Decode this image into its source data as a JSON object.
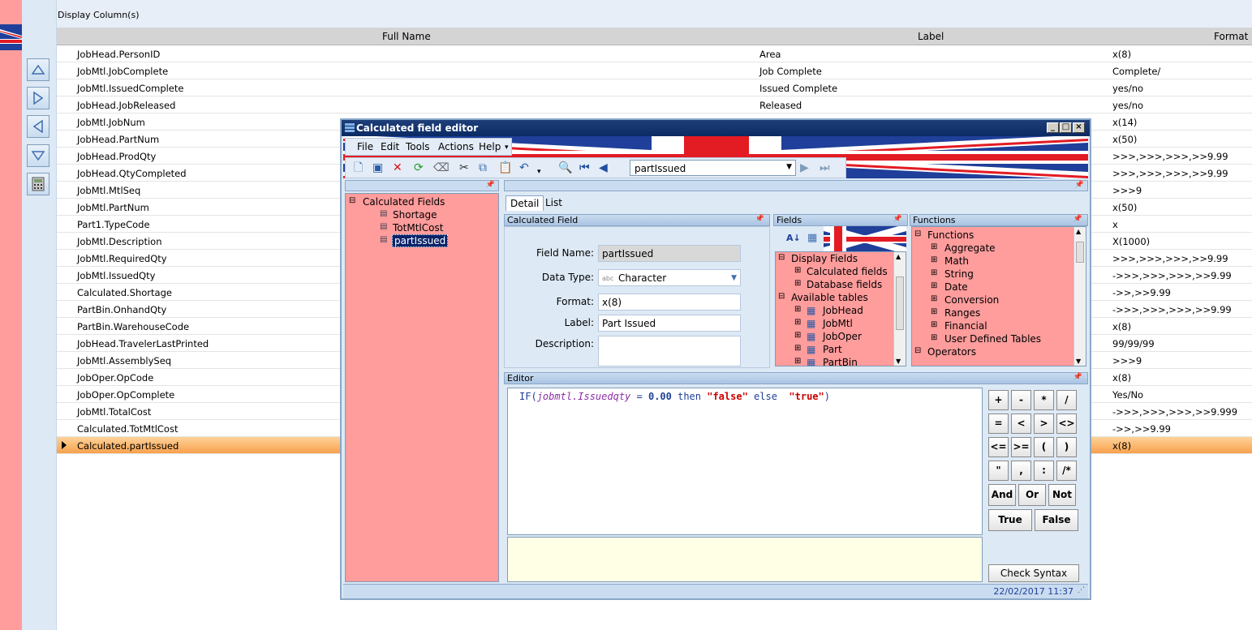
{
  "top_bar": {
    "title": "Display Column(s)"
  },
  "grid": {
    "headers": {
      "full_name": "Full Name",
      "label": "Label",
      "format": "Format"
    },
    "rows": [
      {
        "full_name": "JobHead.PersonID",
        "label": "Area",
        "format": "x(8)"
      },
      {
        "full_name": "JobMtl.JobComplete",
        "label": "Job Complete",
        "format": "Complete/"
      },
      {
        "full_name": "JobMtl.IssuedComplete",
        "label": "Issued Complete",
        "format": "yes/no"
      },
      {
        "full_name": "JobHead.JobReleased",
        "label": "Released",
        "format": "yes/no"
      },
      {
        "full_name": "JobMtl.JobNum",
        "label": "",
        "format": "x(14)"
      },
      {
        "full_name": "JobHead.PartNum",
        "label": "",
        "format": "x(50)"
      },
      {
        "full_name": "JobHead.ProdQty",
        "label": "",
        "format": ">>>,>>>,>>>,>>9.99"
      },
      {
        "full_name": "JobHead.QtyCompleted",
        "label": "",
        "format": ">>>,>>>,>>>,>>9.99"
      },
      {
        "full_name": "JobMtl.MtlSeq",
        "label": "",
        "format": ">>>9"
      },
      {
        "full_name": "JobMtl.PartNum",
        "label": "",
        "format": "x(50)"
      },
      {
        "full_name": "Part1.TypeCode",
        "label": "",
        "format": "x"
      },
      {
        "full_name": "JobMtl.Description",
        "label": "",
        "format": "X(1000)"
      },
      {
        "full_name": "JobMtl.RequiredQty",
        "label": "",
        "format": ">>>,>>>,>>>,>>9.99"
      },
      {
        "full_name": "JobMtl.IssuedQty",
        "label": "",
        "format": "->>>,>>>,>>>,>>9.99"
      },
      {
        "full_name": "Calculated.Shortage",
        "label": "",
        "format": "->>,>>9.99"
      },
      {
        "full_name": "PartBin.OnhandQty",
        "label": "",
        "format": "->>>,>>>,>>>,>>9.99"
      },
      {
        "full_name": "PartBin.WarehouseCode",
        "label": "",
        "format": "x(8)"
      },
      {
        "full_name": "JobHead.TravelerLastPrinted",
        "label": "",
        "format": "99/99/99"
      },
      {
        "full_name": "JobMtl.AssemblySeq",
        "label": "",
        "format": ">>>9"
      },
      {
        "full_name": "JobOper.OpCode",
        "label": "",
        "format": "x(8)"
      },
      {
        "full_name": "JobOper.OpComplete",
        "label": "",
        "format": "Yes/No"
      },
      {
        "full_name": "JobMtl.TotalCost",
        "label": "",
        "format": "->>>,>>>,>>>,>>9.999"
      },
      {
        "full_name": "Calculated.TotMtlCost",
        "label": "",
        "format": "->>,>>9.99"
      },
      {
        "full_name": "Calculated.partIssued",
        "label": "",
        "format": "x(8)"
      }
    ]
  },
  "dialog": {
    "title": "Calculated field editor",
    "menu": [
      "File",
      "Edit",
      "Tools",
      "Actions",
      "Help"
    ],
    "search_value": "partIssued",
    "tree": {
      "root": "Calculated Fields",
      "items": [
        "Shortage",
        "TotMtlCost",
        "partIssued"
      ]
    },
    "tabs": [
      "Detail",
      "List"
    ],
    "calc_panel": {
      "header": "Calculated Field",
      "field_name_label": "Field Name:",
      "field_name": "partIssued",
      "data_type_label": "Data Type:",
      "data_type_prefix": "abc",
      "data_type": "Character",
      "format_label": "Format:",
      "format": "x(8)",
      "label_label": "Label:",
      "label": "Part Issued",
      "description_label": "Description:"
    },
    "fields_panel": {
      "header": "Fields",
      "display_fields": "Display Fields",
      "calculated_fields": "Calculated fields",
      "database_fields": "Database fields",
      "available_tables": "Available tables",
      "tables": [
        "JobHead",
        "JobMtl",
        "JobOper",
        "Part",
        "PartBin"
      ]
    },
    "functions_panel": {
      "header": "Functions",
      "root": "Functions",
      "items": [
        "Aggregate",
        "Math",
        "String",
        "Date",
        "Conversion",
        "Ranges",
        "Financial",
        "User Defined Tables"
      ],
      "operators": "Operators"
    },
    "editor": {
      "header": "Editor",
      "code": {
        "kw_if": "IF(",
        "ident": "jobmtl.Issuedqty",
        "eq": " = ",
        "num": "0.00",
        "then": " then ",
        "str1": "\"false\"",
        "else": " else  ",
        "str2": "\"true\"",
        "close": ")"
      }
    },
    "keypad": [
      "+",
      "-",
      "*",
      "/",
      "=",
      "<",
      ">",
      "<>",
      "<=",
      ">=",
      "(",
      ")",
      "\"",
      ",",
      ":",
      "/*"
    ],
    "logic": [
      "And",
      "Or",
      "Not"
    ],
    "bools": [
      "True",
      "False"
    ],
    "check_syntax": "Check Syntax",
    "status": "22/02/2017  11:37"
  }
}
